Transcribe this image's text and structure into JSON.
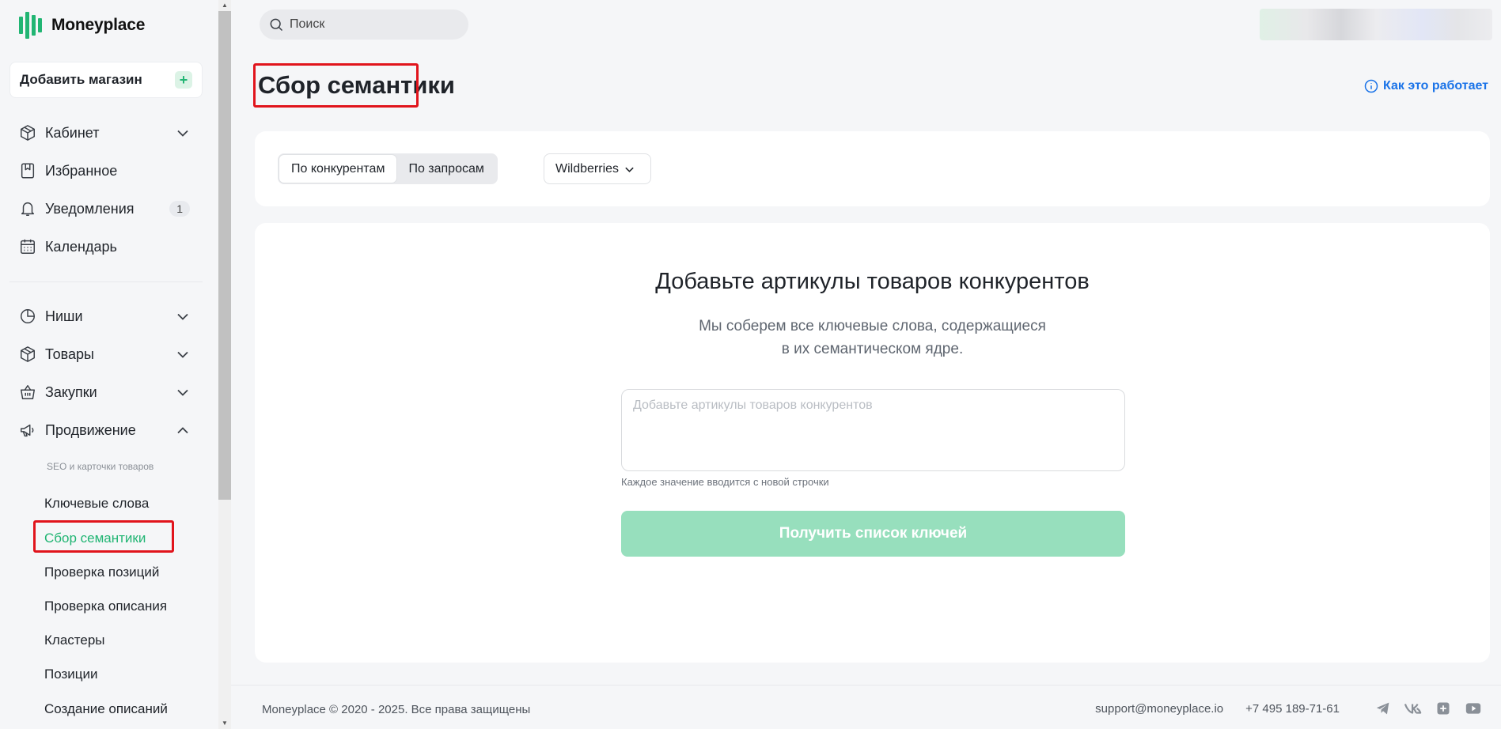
{
  "brand": {
    "name": "Moneyplace",
    "accent": "#21b573"
  },
  "sidebar": {
    "add_store": "Добавить магазин",
    "items": [
      {
        "label": "Кабинет",
        "icon": "box-icon"
      },
      {
        "label": "Избранное",
        "icon": "bookmark-icon"
      },
      {
        "label": "Уведомления",
        "icon": "bell-icon",
        "badge": "1"
      },
      {
        "label": "Календарь",
        "icon": "calendar-icon"
      },
      {
        "label": "Ниши",
        "icon": "pie-chart-icon"
      },
      {
        "label": "Товары",
        "icon": "box-icon"
      },
      {
        "label": "Закупки",
        "icon": "basket-icon"
      },
      {
        "label": "Продвижение",
        "icon": "megaphone-icon"
      }
    ],
    "section_caption": "SEO и карточки товаров",
    "sub_items": [
      {
        "label": "Ключевые слова"
      },
      {
        "label": "Сбор семантики",
        "active": true
      },
      {
        "label": "Проверка позиций"
      },
      {
        "label": "Проверка описания"
      },
      {
        "label": "Кластеры"
      },
      {
        "label": "Позиции"
      },
      {
        "label": "Создание описаний"
      }
    ]
  },
  "header": {
    "search_placeholder": "Поиск"
  },
  "page": {
    "title": "Сбор семантики",
    "how_it_works": "Как это работает"
  },
  "toolbar": {
    "tabs": [
      {
        "label": "По конкурентам",
        "active": true
      },
      {
        "label": "По запросам"
      }
    ],
    "marketplace": "Wildberries"
  },
  "content": {
    "title": "Добавьте артикулы товаров конкурентов",
    "desc_line1": "Мы соберем все ключевые слова, содержащиеся",
    "desc_line2": "в их семантическом ядре.",
    "textarea_placeholder": "Добавьте артикулы товаров конкурентов",
    "hint": "Каждое значение вводится с новой строчки",
    "submit": "Получить список ключей"
  },
  "footer": {
    "copyright": "Moneyplace © 2020 - 2025. Все права защищены",
    "email": "support@moneyplace.io",
    "phone": "+7 495 189-71-61",
    "socials": [
      "telegram-icon",
      "vk-icon",
      "plus-square-icon",
      "youtube-icon"
    ]
  }
}
